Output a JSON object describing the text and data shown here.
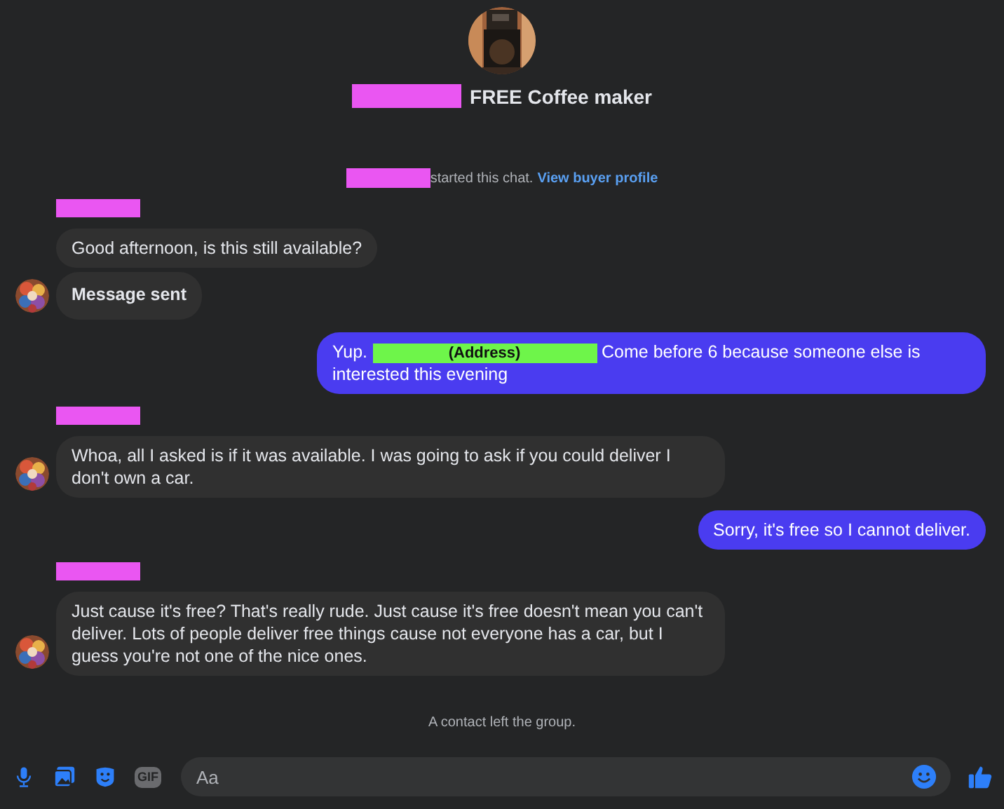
{
  "header": {
    "title_prefix": {
      "kind": "redacted"
    },
    "title": "FREE Coffee maker"
  },
  "start_note": {
    "actor": {
      "kind": "redacted"
    },
    "text": "started this chat.",
    "link": "View buyer profile"
  },
  "groups": [
    {
      "kind": "incoming",
      "sender": {
        "kind": "redacted"
      },
      "bubbles": [
        {
          "bold": false,
          "parts": [
            {
              "kind": "text",
              "text": "Good afternoon, is this still available?"
            }
          ]
        },
        {
          "bold": true,
          "parts": [
            {
              "kind": "text",
              "text": "Message sent"
            }
          ]
        }
      ]
    },
    {
      "kind": "outgoing",
      "bubbles": [
        {
          "bold": false,
          "parts": [
            {
              "kind": "text",
              "text": "Yup."
            },
            {
              "kind": "redaction",
              "text": "(Address)"
            },
            {
              "kind": "text",
              "text": "Come before 6 because someone else is interested this evening"
            }
          ]
        }
      ]
    },
    {
      "kind": "incoming",
      "sender": {
        "kind": "redacted"
      },
      "bubbles": [
        {
          "bold": false,
          "parts": [
            {
              "kind": "text",
              "text": "Whoa, all I asked is if it was available. I was going to ask if you could deliver I don't own a car."
            }
          ]
        }
      ]
    },
    {
      "kind": "outgoing",
      "bubbles": [
        {
          "bold": false,
          "parts": [
            {
              "kind": "text",
              "text": "Sorry, it's free so I cannot deliver."
            }
          ]
        }
      ]
    },
    {
      "kind": "incoming",
      "sender": {
        "kind": "redacted"
      },
      "bubbles": [
        {
          "bold": false,
          "parts": [
            {
              "kind": "text",
              "text": "Just cause it's free? That's really rude. Just cause it's free doesn't mean you can't deliver. Lots of people deliver free things cause not everyone has a car, but I guess you're not one of the nice ones."
            }
          ]
        }
      ]
    }
  ],
  "footer_note": "A contact left the group.",
  "composer": {
    "gif_label": "GIF",
    "placeholder": "Aa"
  }
}
